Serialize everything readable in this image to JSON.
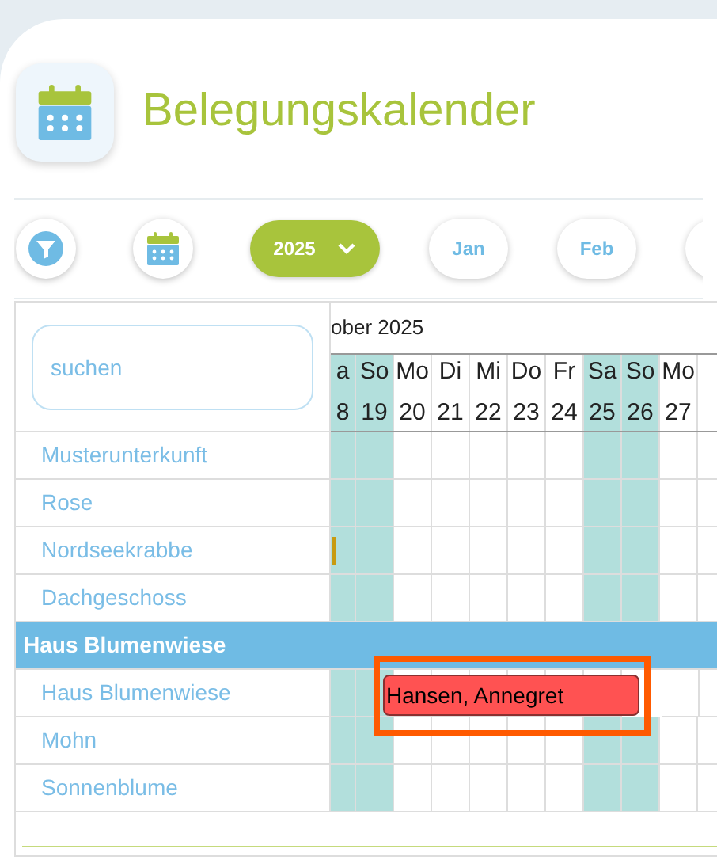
{
  "header": {
    "title": "Belegungskalender"
  },
  "toolbar": {
    "year": "2025",
    "months": [
      {
        "label": "Jan",
        "selected": false
      },
      {
        "label": "Feb",
        "selected": false
      }
    ]
  },
  "calendar": {
    "search": {
      "placeholder": "suchen"
    },
    "month_label": "ober 2025",
    "days": [
      {
        "name": "a",
        "number": "8",
        "weekend": true
      },
      {
        "name": "So",
        "number": "19",
        "weekend": true
      },
      {
        "name": "Mo",
        "number": "20",
        "weekend": false
      },
      {
        "name": "Di",
        "number": "21",
        "weekend": false
      },
      {
        "name": "Mi",
        "number": "22",
        "weekend": false
      },
      {
        "name": "Do",
        "number": "23",
        "weekend": false
      },
      {
        "name": "Fr",
        "number": "24",
        "weekend": false
      },
      {
        "name": "Sa",
        "number": "25",
        "weekend": true
      },
      {
        "name": "So",
        "number": "26",
        "weekend": true
      },
      {
        "name": "Mo",
        "number": "27",
        "weekend": false
      }
    ],
    "rows": [
      {
        "kind": "unit",
        "name": "Musterunterkunft"
      },
      {
        "kind": "unit",
        "name": "Rose"
      },
      {
        "kind": "unit",
        "name": "Nordseekrabbe",
        "partial_booking": {
          "color": "#c89a10"
        }
      },
      {
        "kind": "unit",
        "name": "Dachgeschoss"
      },
      {
        "kind": "group",
        "name": "Haus Blumenwiese"
      },
      {
        "kind": "unit",
        "name": "Haus Blumenwiese",
        "booking": {
          "guest": "Hansen, Annegret",
          "color": "#ff5252",
          "highlighted": true
        }
      },
      {
        "kind": "unit",
        "name": "Mohn"
      },
      {
        "kind": "unit",
        "name": "Sonnenblume"
      }
    ]
  }
}
